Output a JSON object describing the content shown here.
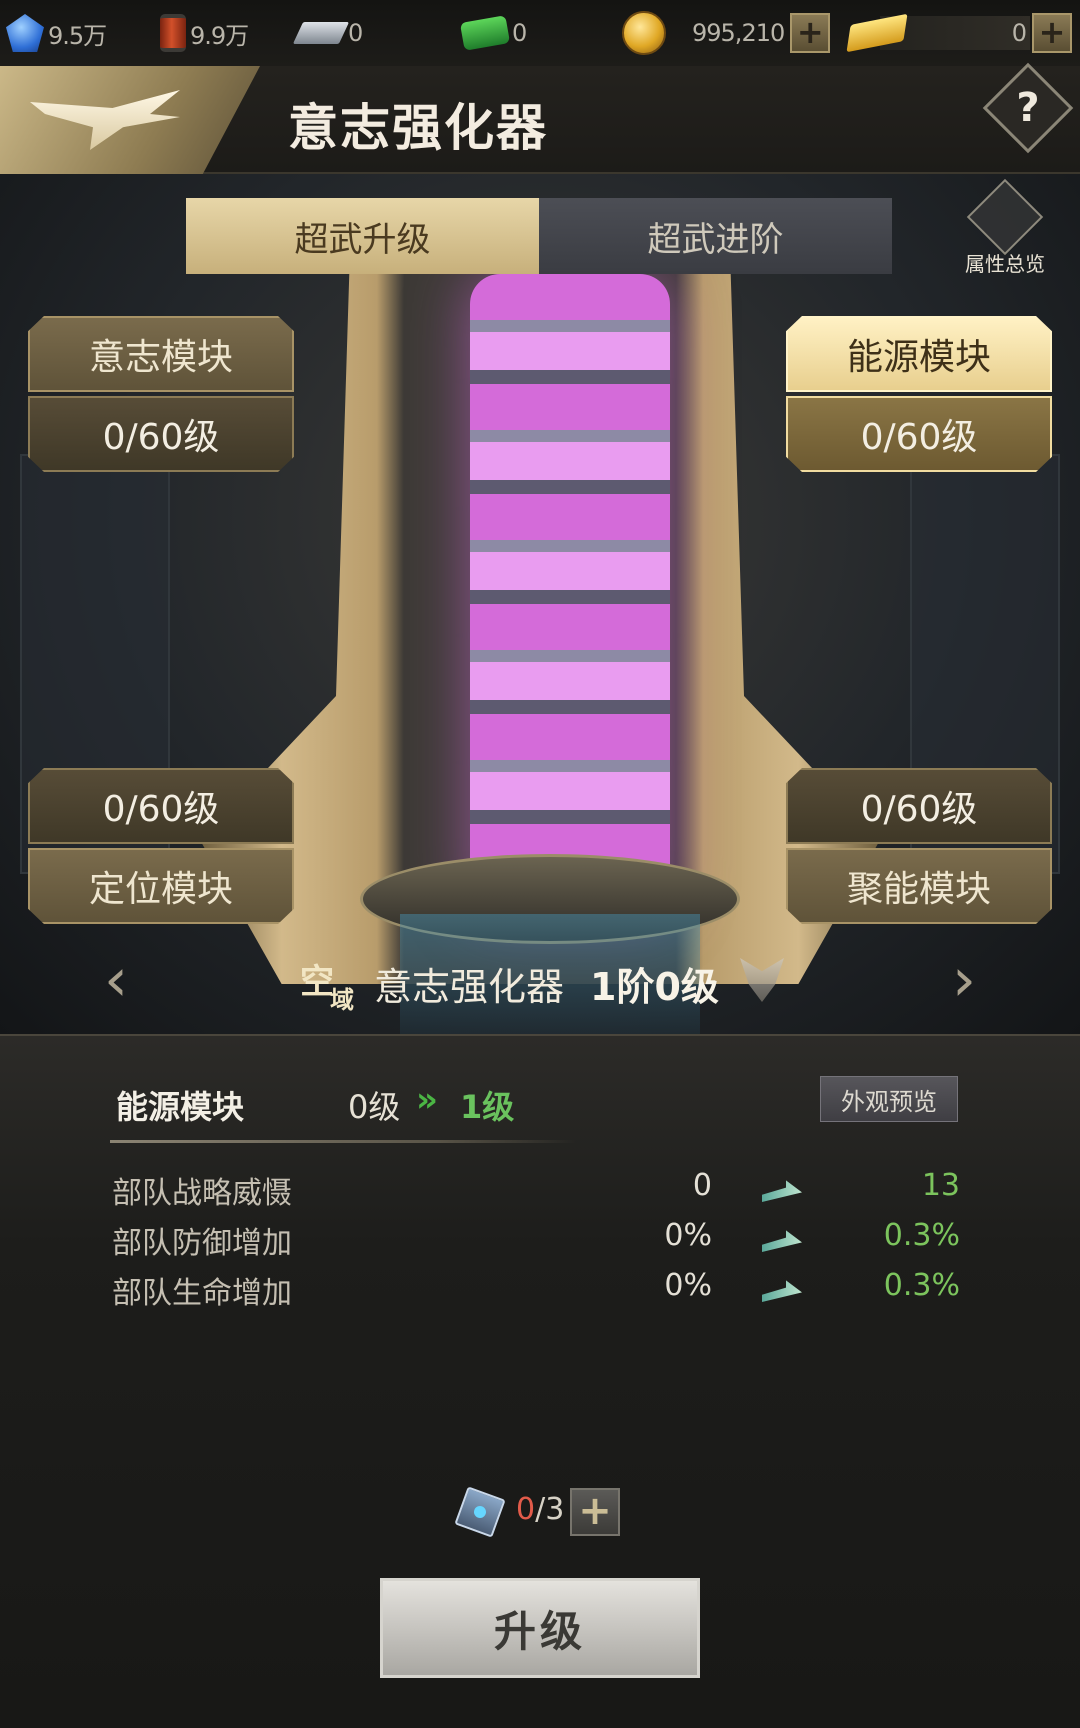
{
  "resources": [
    {
      "icon": "gem-icon",
      "value": "9.5万"
    },
    {
      "icon": "oil-barrel-icon",
      "value": "9.9万"
    },
    {
      "icon": "steel-icon",
      "value": "0"
    },
    {
      "icon": "cash-icon",
      "value": "0"
    },
    {
      "icon": "coin-icon",
      "value": "995,210"
    },
    {
      "icon": "gold-bar-icon",
      "value": "0"
    }
  ],
  "header": {
    "title": "意志强化器",
    "help_label": "?"
  },
  "tabs": [
    {
      "label": "超武升级",
      "active": true
    },
    {
      "label": "超武进阶",
      "active": false
    }
  ],
  "attribute_overview_label": "属性总览",
  "modules": [
    {
      "name": "意志模块",
      "level": "0/60级",
      "selected": false
    },
    {
      "name": "能源模块",
      "level": "0/60级",
      "selected": true
    },
    {
      "name": "定位模块",
      "level": "0/60级",
      "selected": false
    },
    {
      "name": "聚能模块",
      "level": "0/60级",
      "selected": false
    }
  ],
  "weapon": {
    "domain_1": "空",
    "domain_2": "域",
    "name": "意志强化器",
    "stage": "1阶0级"
  },
  "detail": {
    "module_name": "能源模块",
    "level_from": "0级",
    "level_arrows": "»",
    "level_to": "1级",
    "preview_label": "外观预览",
    "stats": [
      {
        "name": "部队战略威慑",
        "current": "0",
        "next": "13"
      },
      {
        "name": "部队防御增加",
        "current": "0%",
        "next": "0.3%"
      },
      {
        "name": "部队生命增加",
        "current": "0%",
        "next": "0.3%"
      }
    ]
  },
  "consumable": {
    "have": "0",
    "need": "/3",
    "plus": "+"
  },
  "upgrade_label": "升级",
  "colors": {
    "accent_gold": "#c7b07b",
    "increase_green": "#7cc45d",
    "insufficient_red": "#e25b4a"
  }
}
